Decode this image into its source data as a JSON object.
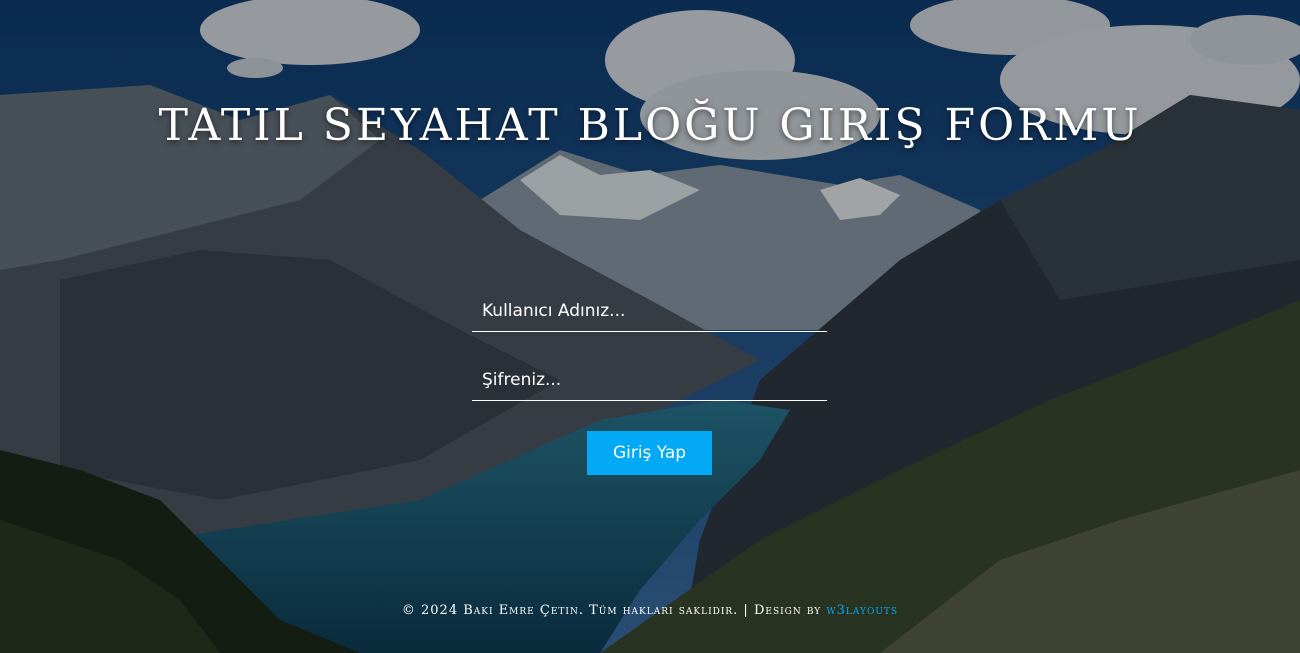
{
  "page": {
    "title": "TATIL SEYAHAT BLOĞU GIRIŞ FORMU"
  },
  "form": {
    "username_placeholder": "Kullanıcı Adınız...",
    "password_placeholder": "Şifreniz...",
    "submit_label": "Giriş Yap"
  },
  "footer": {
    "copyright": "© 2024 Bakı Emre Çetin. Tüm hakları saklıdır. | Design by ",
    "link_text": "w3layouts"
  },
  "colors": {
    "accent": "#03a9f4",
    "sky": "#1d4f87",
    "lake": "#1a5c78"
  }
}
